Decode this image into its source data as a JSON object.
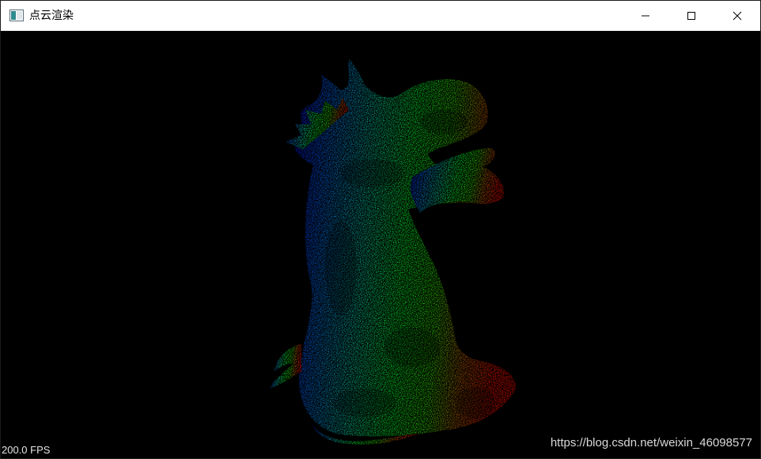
{
  "window": {
    "title": "点云渲染",
    "minimize_icon": "minimize-icon",
    "maximize_icon": "maximize-icon",
    "close_icon": "close-icon"
  },
  "viewport": {
    "background": "#000000",
    "fps_text": "200.0 FPS",
    "watermark": "https://blog.csdn.net/weixin_46098577",
    "gradient_colors": [
      "#0000ff",
      "#00a0ff",
      "#00ff40",
      "#20e000",
      "#ff2000"
    ]
  }
}
